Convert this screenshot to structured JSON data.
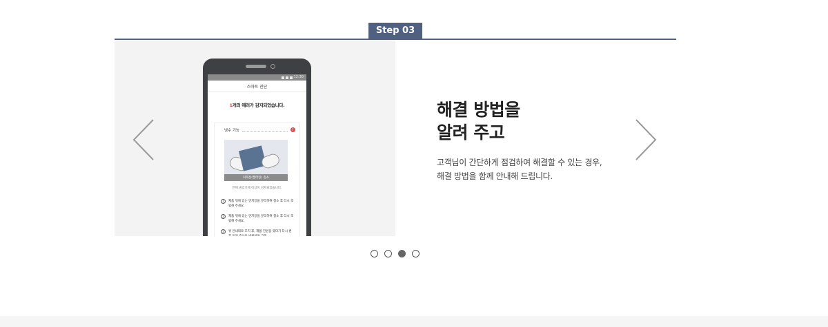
{
  "step": {
    "label": "Step 03",
    "accent_color": "#4f6080"
  },
  "phone_screen": {
    "title": "스마트 진단",
    "error_count": "1",
    "error_text": "개의 에러가 감지되었습니다.",
    "card_label": "냉수 기능",
    "alert_glyph": "!",
    "illustration_caption": "커피잔(필터망) 청소",
    "card_sub": "전체 냉각기에 이상이 감지되었습니다.",
    "guide_steps": [
      {
        "num": "1",
        "text": "제품 뒤에 있는 먼지망을 분리하여 청소 후 다시 조립해 주세요."
      },
      {
        "num": "2",
        "text": "제품 뒤에 있는 먼지망을 분리하여 청소 후 다시 조립해 주세요."
      },
      {
        "num": "3",
        "text": "위 안내대로 조치 후, 제품 전원을 껐다가 다시 켠 후 동일 증상이 반복되면 고객"
      }
    ],
    "status_time": "12:30"
  },
  "content": {
    "title_line1": "해결 방법을",
    "title_line2": "알려 주고",
    "desc_line1": "고객님이 간단하게 점검하여 해결할 수 있는 경우,",
    "desc_line2": "해결 방법을 함께 안내해 드립니다."
  },
  "carousel": {
    "prev_icon": "chevron-left-icon",
    "next_icon": "chevron-right-icon",
    "dots": [
      {
        "active": false
      },
      {
        "active": false
      },
      {
        "active": true
      },
      {
        "active": false
      }
    ]
  }
}
